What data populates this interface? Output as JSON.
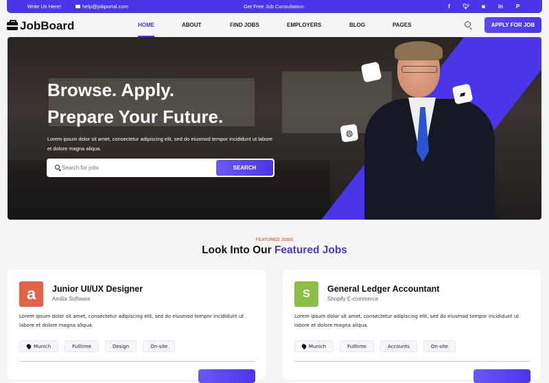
{
  "topbar": {
    "write_label": "Write Us Here!",
    "email": "help@jobportal.com",
    "consultation": "Get Free Job Consultation.",
    "socials": [
      {
        "name": "facebook",
        "glyph": "f"
      },
      {
        "name": "twitter",
        "glyph": "t"
      },
      {
        "name": "instagram",
        "glyph": "◙"
      },
      {
        "name": "linkedin",
        "glyph": "in"
      },
      {
        "name": "pinterest",
        "glyph": "P"
      }
    ]
  },
  "nav": {
    "logo": "JobBoard",
    "items": [
      "HOME",
      "ABOUT",
      "FIND JOBS",
      "EMPLOYERS",
      "BLOG",
      "PAGES"
    ],
    "active": "HOME",
    "apply_label": "APPLY FOR JOB"
  },
  "hero": {
    "line1": "Browse. Apply.",
    "line2": "Prepare Your Future.",
    "description": "Lorem ipsum dolor sit amet, consectetur adipiscing elit, sed do eiusmod tempor incididunt ut labore et dolore magna aliqua.",
    "search_placeholder": "Search for jobs",
    "search_button": "SEARCH",
    "badges": [
      "apple-icon",
      "briefcase-icon",
      "dribbble-icon"
    ]
  },
  "featured": {
    "eyebrow": "FEATURED JOBS",
    "title_plain": "Look Into Our ",
    "title_highlight": "Featured Jobs",
    "jobs": [
      {
        "title": "Junior UI/UX Designer",
        "company": "Amilia Software",
        "logo_letter": "a",
        "logo_color": "#e2624a",
        "description": "Lorem ipsum dolor sit amet, consectetur adipiscing elit, sed do eiusmod tempor incididunt ut labore et dolore magna aliqua.",
        "tags": [
          "Munich",
          "Fulltime",
          "Design",
          "On-site"
        ]
      },
      {
        "title": "General Ledger Accountant",
        "company": "Shopify E-commerce",
        "logo_letter": "S",
        "logo_color": "#8bbf44",
        "description": "Lorem ipsum dolor sit amet, consectetur adipiscing elit, sed do eiusmod tempor incididunt ut labore et dolore magna aliqua.",
        "tags": [
          "Munich",
          "Fulltime",
          "Accounts",
          "On-site"
        ]
      }
    ]
  },
  "colors": {
    "accent": "#4a36e8",
    "eyebrow": "#e06a4e"
  }
}
